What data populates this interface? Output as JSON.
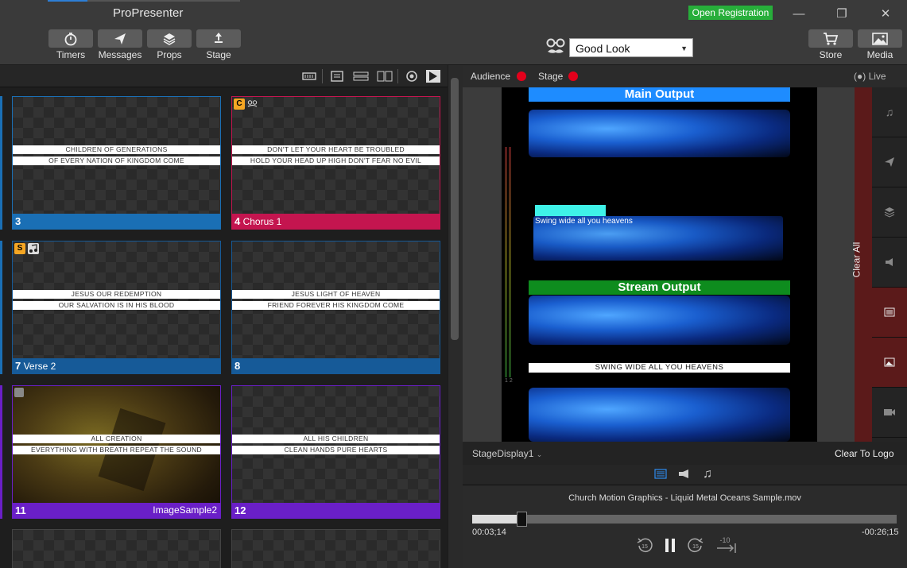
{
  "app": {
    "title": "ProPresenter",
    "open_registration": "Open Registration"
  },
  "toolbar": [
    {
      "label": "Timers",
      "icon": "timer-icon"
    },
    {
      "label": "Messages",
      "icon": "send-icon"
    },
    {
      "label": "Props",
      "icon": "layers-icon"
    },
    {
      "label": "Stage",
      "icon": "stage-icon"
    }
  ],
  "right_toolbar": [
    {
      "label": "Store",
      "icon": "cart-icon"
    },
    {
      "label": "Media",
      "icon": "image-icon"
    }
  ],
  "look": {
    "selected": "Good Look"
  },
  "slides": [
    {
      "number": "3",
      "label": "",
      "line1": "CHILDREN OF GENERATIONS",
      "line2": "OF EVERY NATION OF KINGDOM COME",
      "color": "blue"
    },
    {
      "number": "4",
      "label": "Chorus 1",
      "line1": "DON'T LET YOUR HEART BE TROUBLED",
      "line2": "HOLD YOUR HEAD UP HIGH DON'T FEAR NO EVIL",
      "color": "pink",
      "badge": "C"
    },
    {
      "number": "7",
      "label": "Verse 2",
      "line1": "JESUS OUR REDEMPTION",
      "line2": "OUR SALVATION IS IN HIS BLOOD",
      "color": "navy",
      "badge": "S"
    },
    {
      "number": "8",
      "label": "",
      "line1": "JESUS LIGHT OF HEAVEN",
      "line2": "FRIEND FOREVER HIS KINGDOM COME",
      "color": "navy"
    },
    {
      "number": "11",
      "label": "",
      "right_label": "ImageSample2",
      "line1": "ALL CREATION",
      "line2": "EVERYTHING WITH BREATH REPEAT THE SOUND",
      "color": "purple"
    },
    {
      "number": "12",
      "label": "",
      "line1": "ALL HIS CHILDREN",
      "line2": "CLEAN HANDS PURE HEARTS",
      "color": "purple"
    }
  ],
  "outputs": {
    "audience": "Audience",
    "stage": "Stage",
    "live": "Live",
    "main_output": "Main Output",
    "stream_output": "Stream Output",
    "main_caption": "Swing wide all you heavens",
    "stream_caption": "SWING WIDE ALL YOU HEAVENS",
    "clear_all": "Clear All",
    "meter_label": "1 2"
  },
  "stage_display": {
    "selected": "StageDisplay1",
    "clear_to_logo": "Clear To Logo"
  },
  "media_player": {
    "title": "Church Motion Graphics - Liquid Metal Oceans Sample.mov",
    "current_time": "00:03;14",
    "remaining_time": "-00:26;15",
    "progress": 0.117,
    "skip_back": "15",
    "skip_forward": "15",
    "skip_minus": "-10"
  },
  "colors": {
    "blue": "#1a6fb5",
    "pink": "#c4154f",
    "navy": "#165a98",
    "purple": "#6a1fc7",
    "live_red": "#e4001b",
    "registration_green": "#27ae3a"
  }
}
